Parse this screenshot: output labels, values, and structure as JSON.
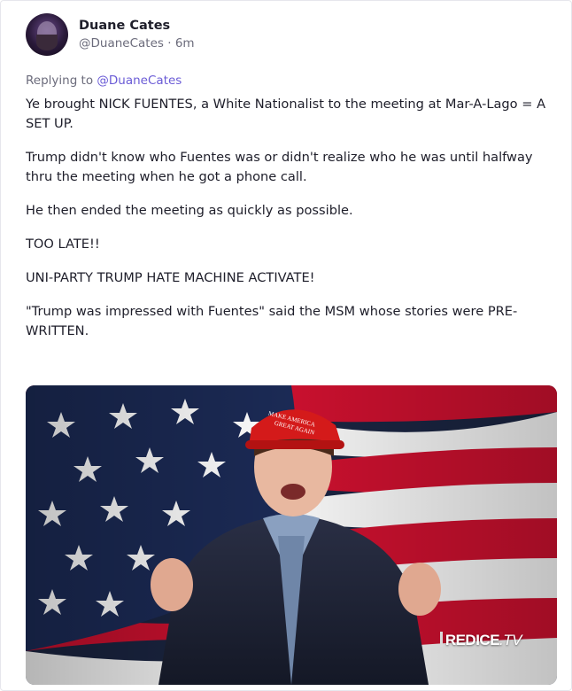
{
  "author": {
    "display_name": "Duane Cates",
    "handle": "@DuaneCates",
    "time": "6m"
  },
  "reply": {
    "prefix": "Replying to",
    "mention": "@DuaneCates"
  },
  "paragraphs": [
    "Ye brought NICK FUENTES, a White Nationalist to the meeting at Mar-A-Lago = A SET UP.",
    "Trump didn't know who Fuentes was or didn't realize who he was until halfway thru the meeting when he got a phone call.",
    "He then ended the meeting as quickly as possible.",
    "TOO LATE!!",
    "UNI-PARTY TRUMP HATE MACHINE ACTIVATE!",
    "\"Trump was impressed with Fuentes\" said the MSM whose stories were PRE-WRITTEN."
  ],
  "media": {
    "hat_text_line1": "MAKE AMERICA",
    "hat_text_line2": "GREAT AGAIN",
    "watermark_main": "REDICE",
    "watermark_suffix": ".TV"
  },
  "colors": {
    "mention": "#6a5bd6",
    "flag_blue": "#1b2a55",
    "flag_red": "#c8102e",
    "hat_red": "#d41a1a"
  }
}
